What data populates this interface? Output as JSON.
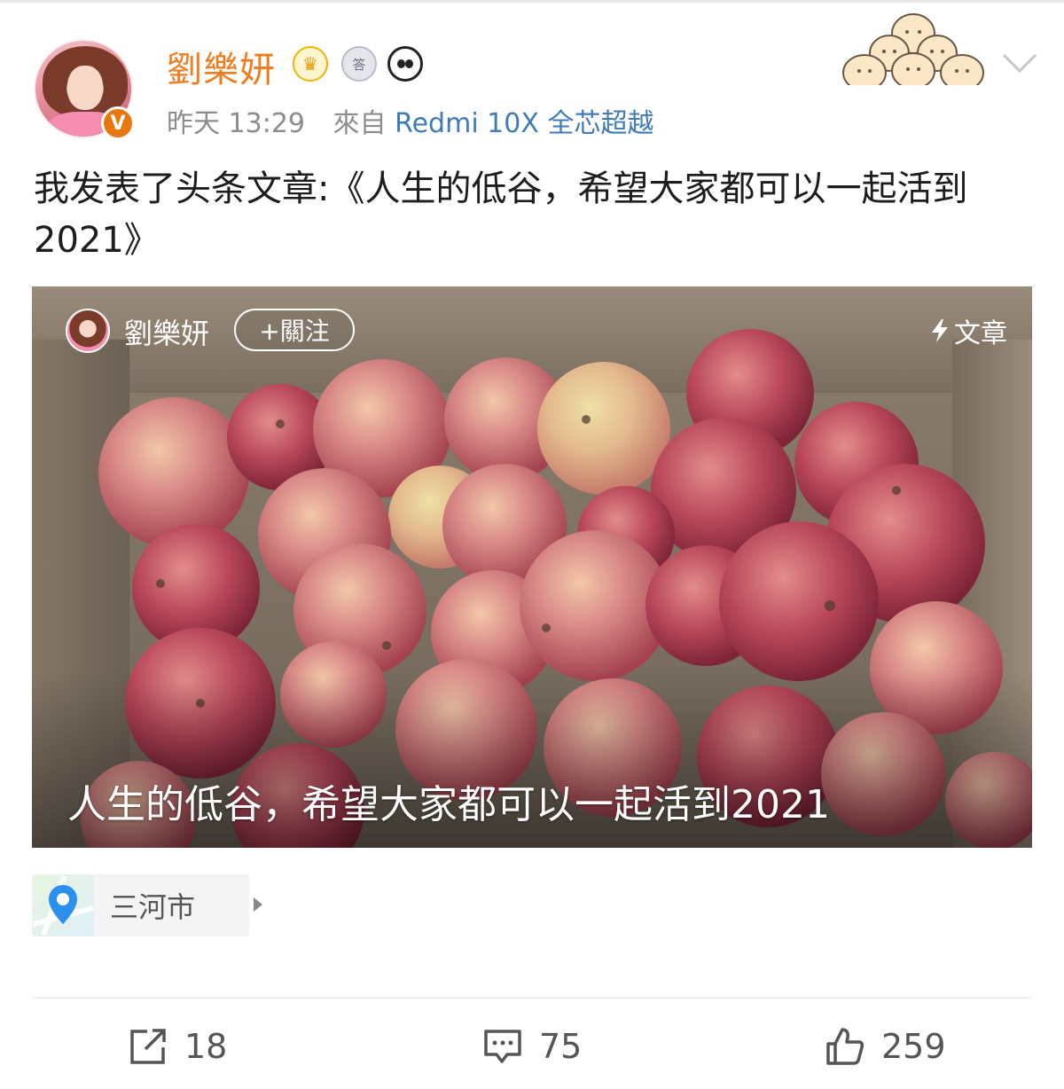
{
  "post": {
    "author": "劉樂妍",
    "badges": [
      "crown-badge-icon",
      "medal-badge-icon",
      "panda-badge-icon"
    ],
    "verified_mark": "V",
    "time": "昨天 13:29",
    "source_prefix": "來自",
    "source_device": "Redmi 10X 全芯超越",
    "text": "我发表了头条文章:《人生的低谷，希望大家都可以一起活到2021》"
  },
  "article_card": {
    "author": "劉樂妍",
    "follow_label": "+關注",
    "type_label": "文章",
    "title": "人生的低谷，希望大家都可以一起活到2021"
  },
  "location": {
    "name": "三河市"
  },
  "actions": {
    "repost_count": "18",
    "comment_count": "75",
    "like_count": "259"
  },
  "colors": {
    "username": "#f07c20",
    "link": "#3f7bb8",
    "verified": "#e8780e"
  }
}
